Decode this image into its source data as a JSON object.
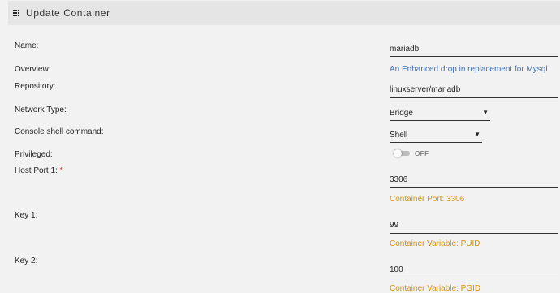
{
  "header": {
    "title": "Update Container",
    "icon": "apps-grid-icon"
  },
  "fields": {
    "name": {
      "label": "Name:",
      "value": "mariadb"
    },
    "overview": {
      "label": "Overview:",
      "value": "An Enhanced drop in replacement for Mysql"
    },
    "repository": {
      "label": "Repository:",
      "value": "linuxserver/mariadb"
    },
    "network_type": {
      "label": "Network Type:",
      "value": "Bridge",
      "caret": "▼"
    },
    "console_shell": {
      "label": "Console shell command:",
      "value": "Shell",
      "caret": "▼"
    },
    "privileged": {
      "label": "Privileged:",
      "state": "OFF"
    },
    "host_port_1": {
      "label": "Host Port 1:",
      "required": "*",
      "value": "3306",
      "hint": "Container Port: 3306"
    },
    "key_1": {
      "label": "Key 1:",
      "value": "99",
      "hint": "Container Variable: PUID"
    },
    "key_2": {
      "label": "Key 2:",
      "value": "100",
      "hint": "Container Variable: PGID"
    }
  },
  "colors": {
    "link": "#3f6fb3",
    "hint": "#d4930c",
    "required": "#d32f2f",
    "header_bg": "#e5e5e5",
    "page_bg": "#f2f2f2"
  }
}
